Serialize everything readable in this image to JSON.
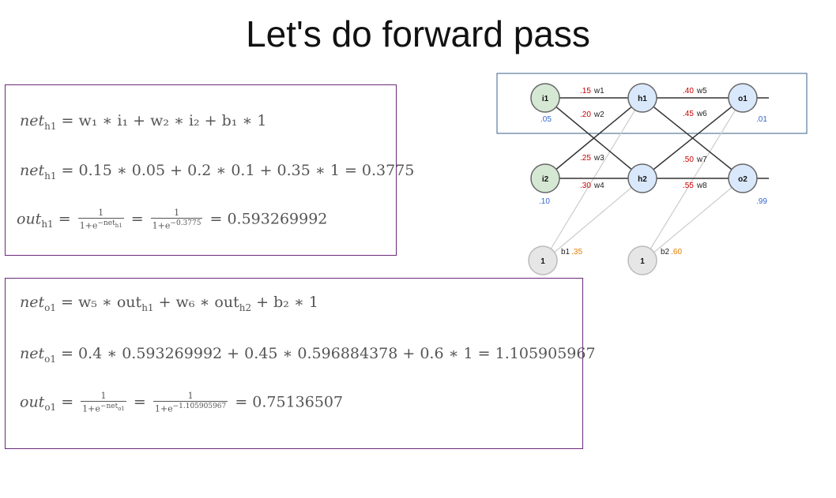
{
  "title": "Let's do forward pass",
  "hidden_eq": {
    "line1_lhs": "net",
    "line1_sub": "h1",
    "line1_rhs": "= w₁ ∗ i₁ + w₂ ∗ i₂ + b₁ ∗ 1",
    "line2_rhs": "= 0.15 ∗ 0.05 + 0.2 ∗ 0.1 + 0.35 ∗ 1 = 0.3775",
    "line3_lhs": "out",
    "line3_den1": "1+e",
    "line3_exp1": "−net",
    "line3_exp1_sub": "h1",
    "line3_den2": "1+e",
    "line3_exp2": "−0.3775",
    "line3_result": "= 0.593269992",
    "one": "1"
  },
  "output_eq": {
    "line1_lhs": "net",
    "line1_sub": "o1",
    "line1_rhs": "= w₅ ∗ out",
    "line1_rhs_sub1": "h1",
    "line1_rhs_mid": " + w₆ ∗ out",
    "line1_rhs_sub2": "h2",
    "line1_rhs_end": " + b₂ ∗ 1",
    "line2_rhs": "= 0.4 ∗ 0.593269992 + 0.45 ∗ 0.596884378 + 0.6 ∗ 1 = 1.105905967",
    "line3_lhs": "out",
    "line3_den1": "1+e",
    "line3_exp1": "−net",
    "line3_exp1_sub": "o1",
    "line3_den2": "1+e",
    "line3_exp2": "−1.105905967",
    "line3_result": "= 0.75136507",
    "one": "1"
  },
  "network": {
    "nodes": {
      "i1": "i1",
      "i2": "i2",
      "h1": "h1",
      "h2": "h2",
      "o1": "o1",
      "o2": "o2",
      "b1": "1",
      "b2": "1"
    },
    "input_values": {
      "i1": ".05",
      "i2": ".10"
    },
    "target_values": {
      "o1": ".01",
      "o2": ".99"
    },
    "weights": {
      "w1": {
        "value": ".15",
        "name": "w1"
      },
      "w2": {
        "value": ".20",
        "name": "w2"
      },
      "w3": {
        "value": ".25",
        "name": "w3"
      },
      "w4": {
        "value": ".30",
        "name": "w4"
      },
      "w5": {
        "value": ".40",
        "name": "w5"
      },
      "w6": {
        "value": ".45",
        "name": "w6"
      },
      "w7": {
        "value": ".50",
        "name": "w7"
      },
      "w8": {
        "value": ".55",
        "name": "w8"
      }
    },
    "biases": {
      "b1": {
        "name": "b1",
        "value": ".35"
      },
      "b2": {
        "name": "b2",
        "value": ".60"
      }
    },
    "colors": {
      "input_fill": "#d5e8d4",
      "hidden_fill": "#dae8fc",
      "bias_fill": "#e6e6e6",
      "weight_value": "#cc0000",
      "bias_value": "#e67e00",
      "io_value": "#3366cc",
      "highlight_border": "#3a5f8a"
    }
  }
}
